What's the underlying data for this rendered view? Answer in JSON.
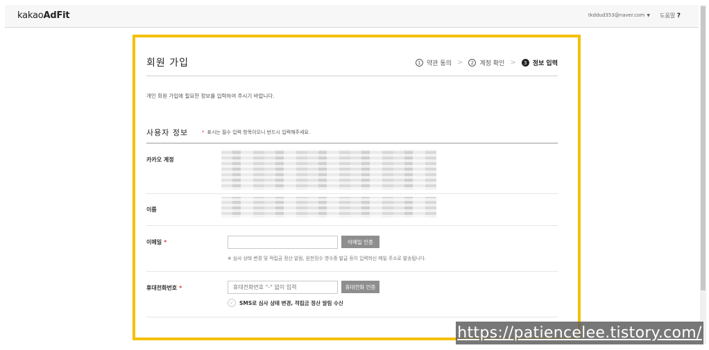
{
  "header": {
    "logo_prefix": "kakao",
    "logo_suffix": "AdFit",
    "user_email": "tkddud353@naver.com",
    "user_caret": "▼",
    "help_label": "도움말",
    "help_mark": "?"
  },
  "page": {
    "title": "회원 가입",
    "steps": [
      {
        "num": "1",
        "label": "약관 동의",
        "active": false
      },
      {
        "num": "2",
        "label": "계정 확인",
        "active": false
      },
      {
        "num": "3",
        "label": "정보 입력",
        "active": true
      }
    ],
    "step_separator": ">",
    "intro": "개인 회원 가입에 필요한 정보를 입력하여 주시기 바랍니다."
  },
  "user_info": {
    "section_title": "사용자 정보",
    "required_star": "*",
    "required_note": "표시는 필수 입력 항목이오니 반드시 입력해주세요.",
    "kakao_account_label": "카카오 계정",
    "name_label": "이름",
    "email": {
      "label": "이메일",
      "required_mark": "*",
      "value": "",
      "placeholder": "",
      "verify_button": "이메일 인증",
      "hint": "※ 심사 상태 변경 및 적립금 정산 알림, 원천징수 영수증 발급 등이 입력하신 메일 주소로 발송됩니다."
    },
    "phone": {
      "label": "휴대전화번호",
      "required_mark": "*",
      "value": "",
      "placeholder": "휴대전화번호 \"-\" 없이 입력",
      "verify_button": "휴대전화 인증",
      "sms_consent_label": "SMS로 심사 상태 변경, 적립금 정산 알림 수신",
      "sms_consent_checked": false
    }
  },
  "watermark": "https://patiencelee.tistory.com/"
}
